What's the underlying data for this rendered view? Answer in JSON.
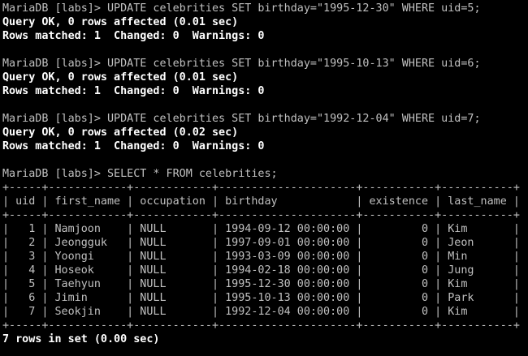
{
  "terminal": {
    "lines": [
      {
        "text": "MariaDB [labs]> UPDATE celebrities SET birthday=\"1995-12-30\" WHERE uid=5;",
        "bold": false
      },
      {
        "text": "Query OK, 0 rows affected (0.01 sec)",
        "bold": true
      },
      {
        "text": "Rows matched: 1  Changed: 0  Warnings: 0",
        "bold": true
      },
      {
        "text": "",
        "bold": false
      },
      {
        "text": "MariaDB [labs]> UPDATE celebrities SET birthday=\"1995-10-13\" WHERE uid=6;",
        "bold": false
      },
      {
        "text": "Query OK, 0 rows affected (0.01 sec)",
        "bold": true
      },
      {
        "text": "Rows matched: 1  Changed: 0  Warnings: 0",
        "bold": true
      },
      {
        "text": "",
        "bold": false
      },
      {
        "text": "MariaDB [labs]> UPDATE celebrities SET birthday=\"1992-12-04\" WHERE uid=7;",
        "bold": false
      },
      {
        "text": "Query OK, 0 rows affected (0.02 sec)",
        "bold": true
      },
      {
        "text": "Rows matched: 1  Changed: 0  Warnings: 0",
        "bold": true
      },
      {
        "text": "",
        "bold": false
      },
      {
        "text": "MariaDB [labs]> SELECT * FROM celebrities;",
        "bold": false
      },
      {
        "text": "+-----+------------+------------+---------------------+-----------+-----------+",
        "bold": false
      },
      {
        "text": "| uid | first_name | occupation | birthday            | existence | last_name |",
        "bold": false
      },
      {
        "text": "+-----+------------+------------+---------------------+-----------+-----------+",
        "bold": false
      },
      {
        "text": "|   1 | Namjoon    | NULL       | 1994-09-12 00:00:00 |         0 | Kim       |",
        "bold": false
      },
      {
        "text": "|   2 | Jeongguk   | NULL       | 1997-09-01 00:00:00 |         0 | Jeon      |",
        "bold": false
      },
      {
        "text": "|   3 | Yoongi     | NULL       | 1993-03-09 00:00:00 |         0 | Min       |",
        "bold": false
      },
      {
        "text": "|   4 | Hoseok     | NULL       | 1994-02-18 00:00:00 |         0 | Jung      |",
        "bold": false
      },
      {
        "text": "|   5 | Taehyun    | NULL       | 1995-12-30 00:00:00 |         0 | Kim       |",
        "bold": false
      },
      {
        "text": "|   6 | Jimin      | NULL       | 1995-10-13 00:00:00 |         0 | Park      |",
        "bold": false
      },
      {
        "text": "|   7 | Seokjin    | NULL       | 1992-12-04 00:00:00 |         0 | Kim       |",
        "bold": false
      },
      {
        "text": "+-----+------------+------------+---------------------+-----------+-----------+",
        "bold": false
      },
      {
        "text": "7 rows in set (0.00 sec)",
        "bold": true
      }
    ]
  },
  "colors": {
    "background": "#000000",
    "text": "#c0c0c0",
    "bold_text": "#ffffff"
  }
}
